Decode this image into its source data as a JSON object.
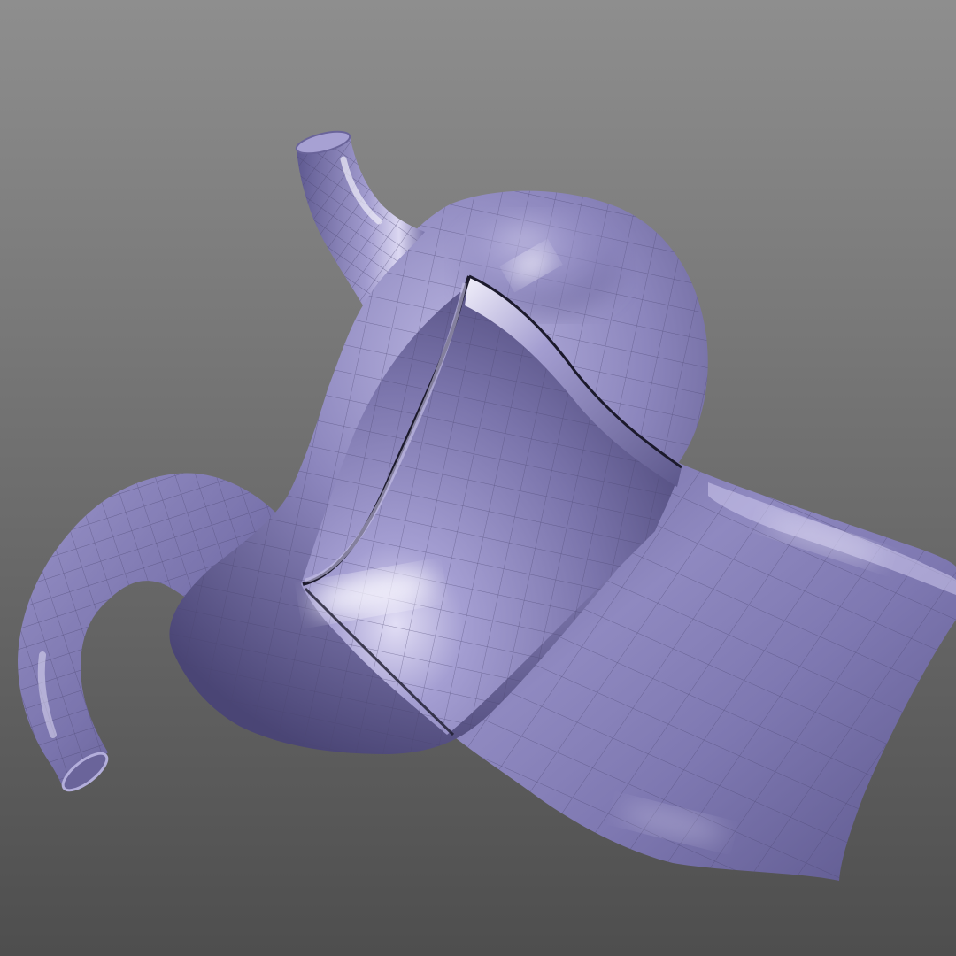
{
  "viewport": {
    "background_top_color": "#8e8e8e",
    "background_bottom_color": "#4e4e4e"
  },
  "model": {
    "subject": "stomach-with-greater-omentum",
    "surface_color": "#8c86bd",
    "surface_light_color": "#d8d4f0",
    "surface_dark_color": "#3c3760",
    "wireframe_color": "#4a4570",
    "cutaway_edge_color": "#1c1a2c"
  }
}
